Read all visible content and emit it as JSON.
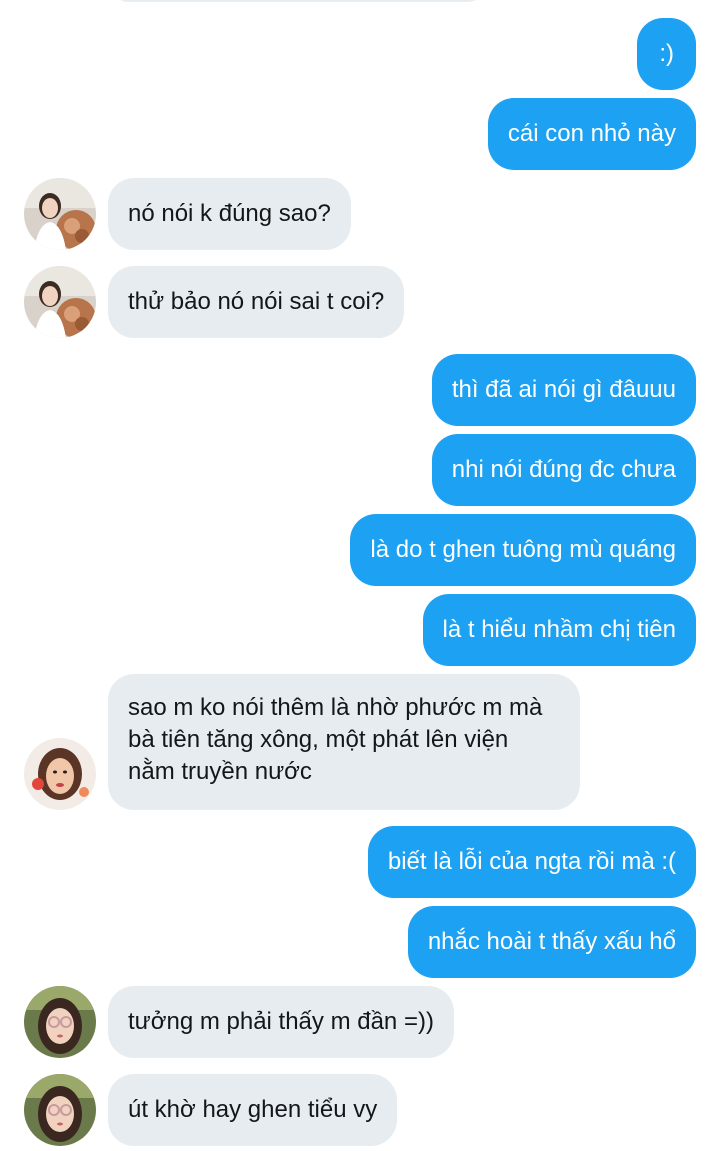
{
  "conversation": {
    "messages": [
      {
        "direction": "outgoing",
        "text": ":)"
      },
      {
        "direction": "outgoing",
        "text": "cái con nhỏ này"
      },
      {
        "direction": "incoming",
        "text": "nó nói k đúng sao?",
        "avatar": "user-avatar-a"
      },
      {
        "direction": "incoming",
        "text": "thử bảo nó nói sai t coi?",
        "avatar": "user-avatar-a"
      },
      {
        "direction": "outgoing",
        "text": "thì đã ai nói gì đâuuu"
      },
      {
        "direction": "outgoing",
        "text": "nhi nói đúng đc chưa"
      },
      {
        "direction": "outgoing",
        "text": "là do t ghen tuông mù quáng"
      },
      {
        "direction": "outgoing",
        "text": "là t hiểu nhầm chị tiên"
      },
      {
        "direction": "incoming",
        "text": "sao m ko nói thêm là nhờ phước m mà bà tiên tăng xông, một phát lên viện nằm truyền nước",
        "avatar": "user-avatar-b"
      },
      {
        "direction": "outgoing",
        "text": "biết là lỗi của ngta rồi mà :("
      },
      {
        "direction": "outgoing",
        "text": "nhắc hoài t thấy xấu hổ"
      },
      {
        "direction": "incoming",
        "text": "tưởng m phải thấy m đần =))",
        "avatar": "user-avatar-c"
      },
      {
        "direction": "incoming",
        "text": "út khờ hay ghen tiểu vy",
        "avatar": "user-avatar-c"
      }
    ]
  },
  "colors": {
    "outgoing_bubble": "#1da1f2",
    "incoming_bubble": "#e6ecf0",
    "outgoing_text": "#ffffff",
    "incoming_text": "#14171a"
  }
}
